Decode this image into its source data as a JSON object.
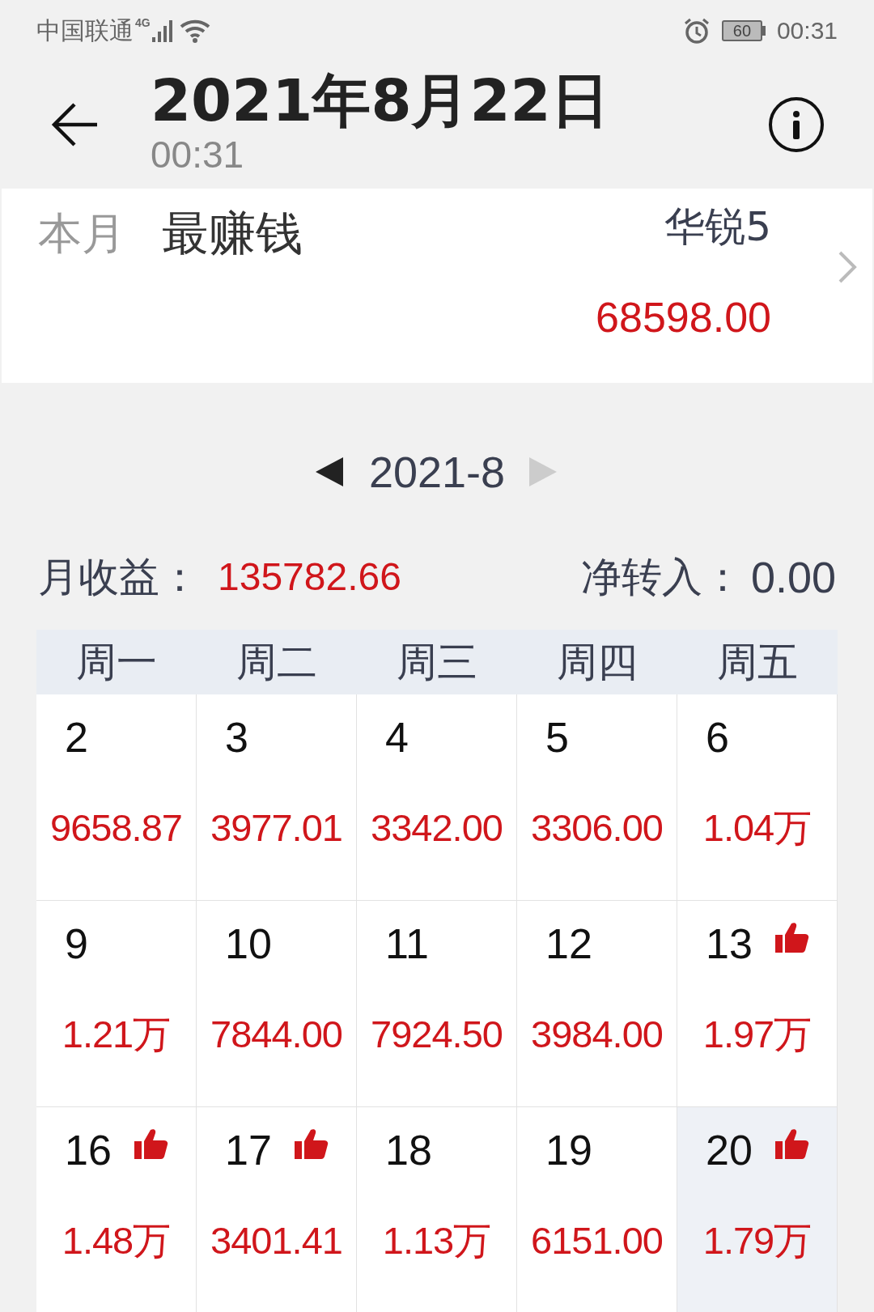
{
  "status_bar": {
    "carrier": "中国联通",
    "network": "4G",
    "time": "00:31",
    "battery": "60"
  },
  "header": {
    "title": "2021年8月22日",
    "subtitle": "00:31"
  },
  "top_card": {
    "period": "本月",
    "label": "最赚钱",
    "stock": "华锐5",
    "amount": "68598.00"
  },
  "month_nav": {
    "month": "2021-8",
    "prev_disabled": false,
    "next_disabled": true
  },
  "summary": {
    "income_label": "月收益：",
    "income": "135782.66",
    "transfer_label": "净转入：",
    "transfer": "0.00"
  },
  "weekdays": [
    "周一",
    "周二",
    "周三",
    "周四",
    "周五"
  ],
  "weeks": [
    [
      {
        "day": "2",
        "value": "9658.87",
        "liked": false,
        "selected": false
      },
      {
        "day": "3",
        "value": "3977.01",
        "liked": false,
        "selected": false
      },
      {
        "day": "4",
        "value": "3342.00",
        "liked": false,
        "selected": false
      },
      {
        "day": "5",
        "value": "3306.00",
        "liked": false,
        "selected": false
      },
      {
        "day": "6",
        "value": "1.04万",
        "liked": false,
        "selected": false
      }
    ],
    [
      {
        "day": "9",
        "value": "1.21万",
        "liked": false,
        "selected": false
      },
      {
        "day": "10",
        "value": "7844.00",
        "liked": false,
        "selected": false
      },
      {
        "day": "11",
        "value": "7924.50",
        "liked": false,
        "selected": false
      },
      {
        "day": "12",
        "value": "3984.00",
        "liked": false,
        "selected": false
      },
      {
        "day": "13",
        "value": "1.97万",
        "liked": true,
        "selected": false
      }
    ],
    [
      {
        "day": "16",
        "value": "1.48万",
        "liked": true,
        "selected": false
      },
      {
        "day": "17",
        "value": "3401.41",
        "liked": true,
        "selected": false
      },
      {
        "day": "18",
        "value": "1.13万",
        "liked": false,
        "selected": false
      },
      {
        "day": "19",
        "value": "6151.00",
        "liked": false,
        "selected": false
      },
      {
        "day": "20",
        "value": "1.79万",
        "liked": true,
        "selected": true
      }
    ]
  ]
}
